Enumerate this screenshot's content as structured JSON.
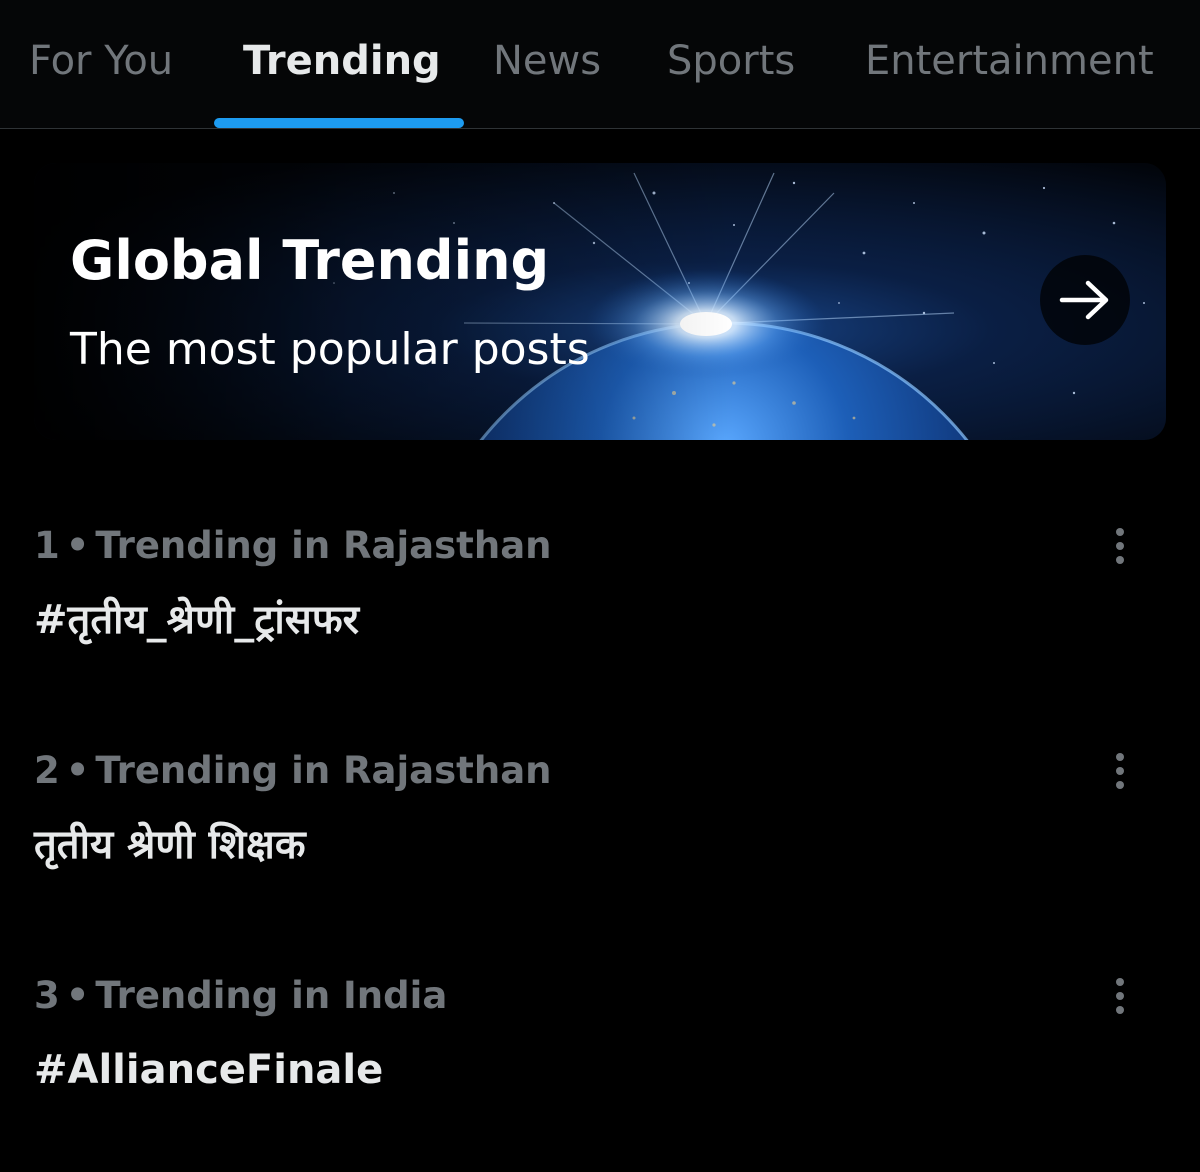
{
  "tabs": [
    {
      "label": "For You"
    },
    {
      "label": "Trending"
    },
    {
      "label": "News"
    },
    {
      "label": "Sports"
    },
    {
      "label": "Entertainment"
    }
  ],
  "active_tab": "Trending",
  "banner": {
    "title": "Global Trending",
    "subtitle": "The most popular posts",
    "arrow_icon": "arrow-right-icon"
  },
  "trends": [
    {
      "rank": "1",
      "context": "Trending in Rajasthan",
      "name": "#तृतीय_श्रेणी_ट्रांसफर"
    },
    {
      "rank": "2",
      "context": "Trending in Rajasthan",
      "name": "तृतीय श्रेणी शिक्षक"
    },
    {
      "rank": "3",
      "context": "Trending in India",
      "name": "#AllianceFinale"
    }
  ],
  "separator": "•",
  "colors": {
    "background": "#000000",
    "accent": "#1d9bf0",
    "primary_text": "#e7e9ea",
    "secondary_text": "#71767b"
  },
  "icons": {
    "more": "more-vertical-icon"
  }
}
